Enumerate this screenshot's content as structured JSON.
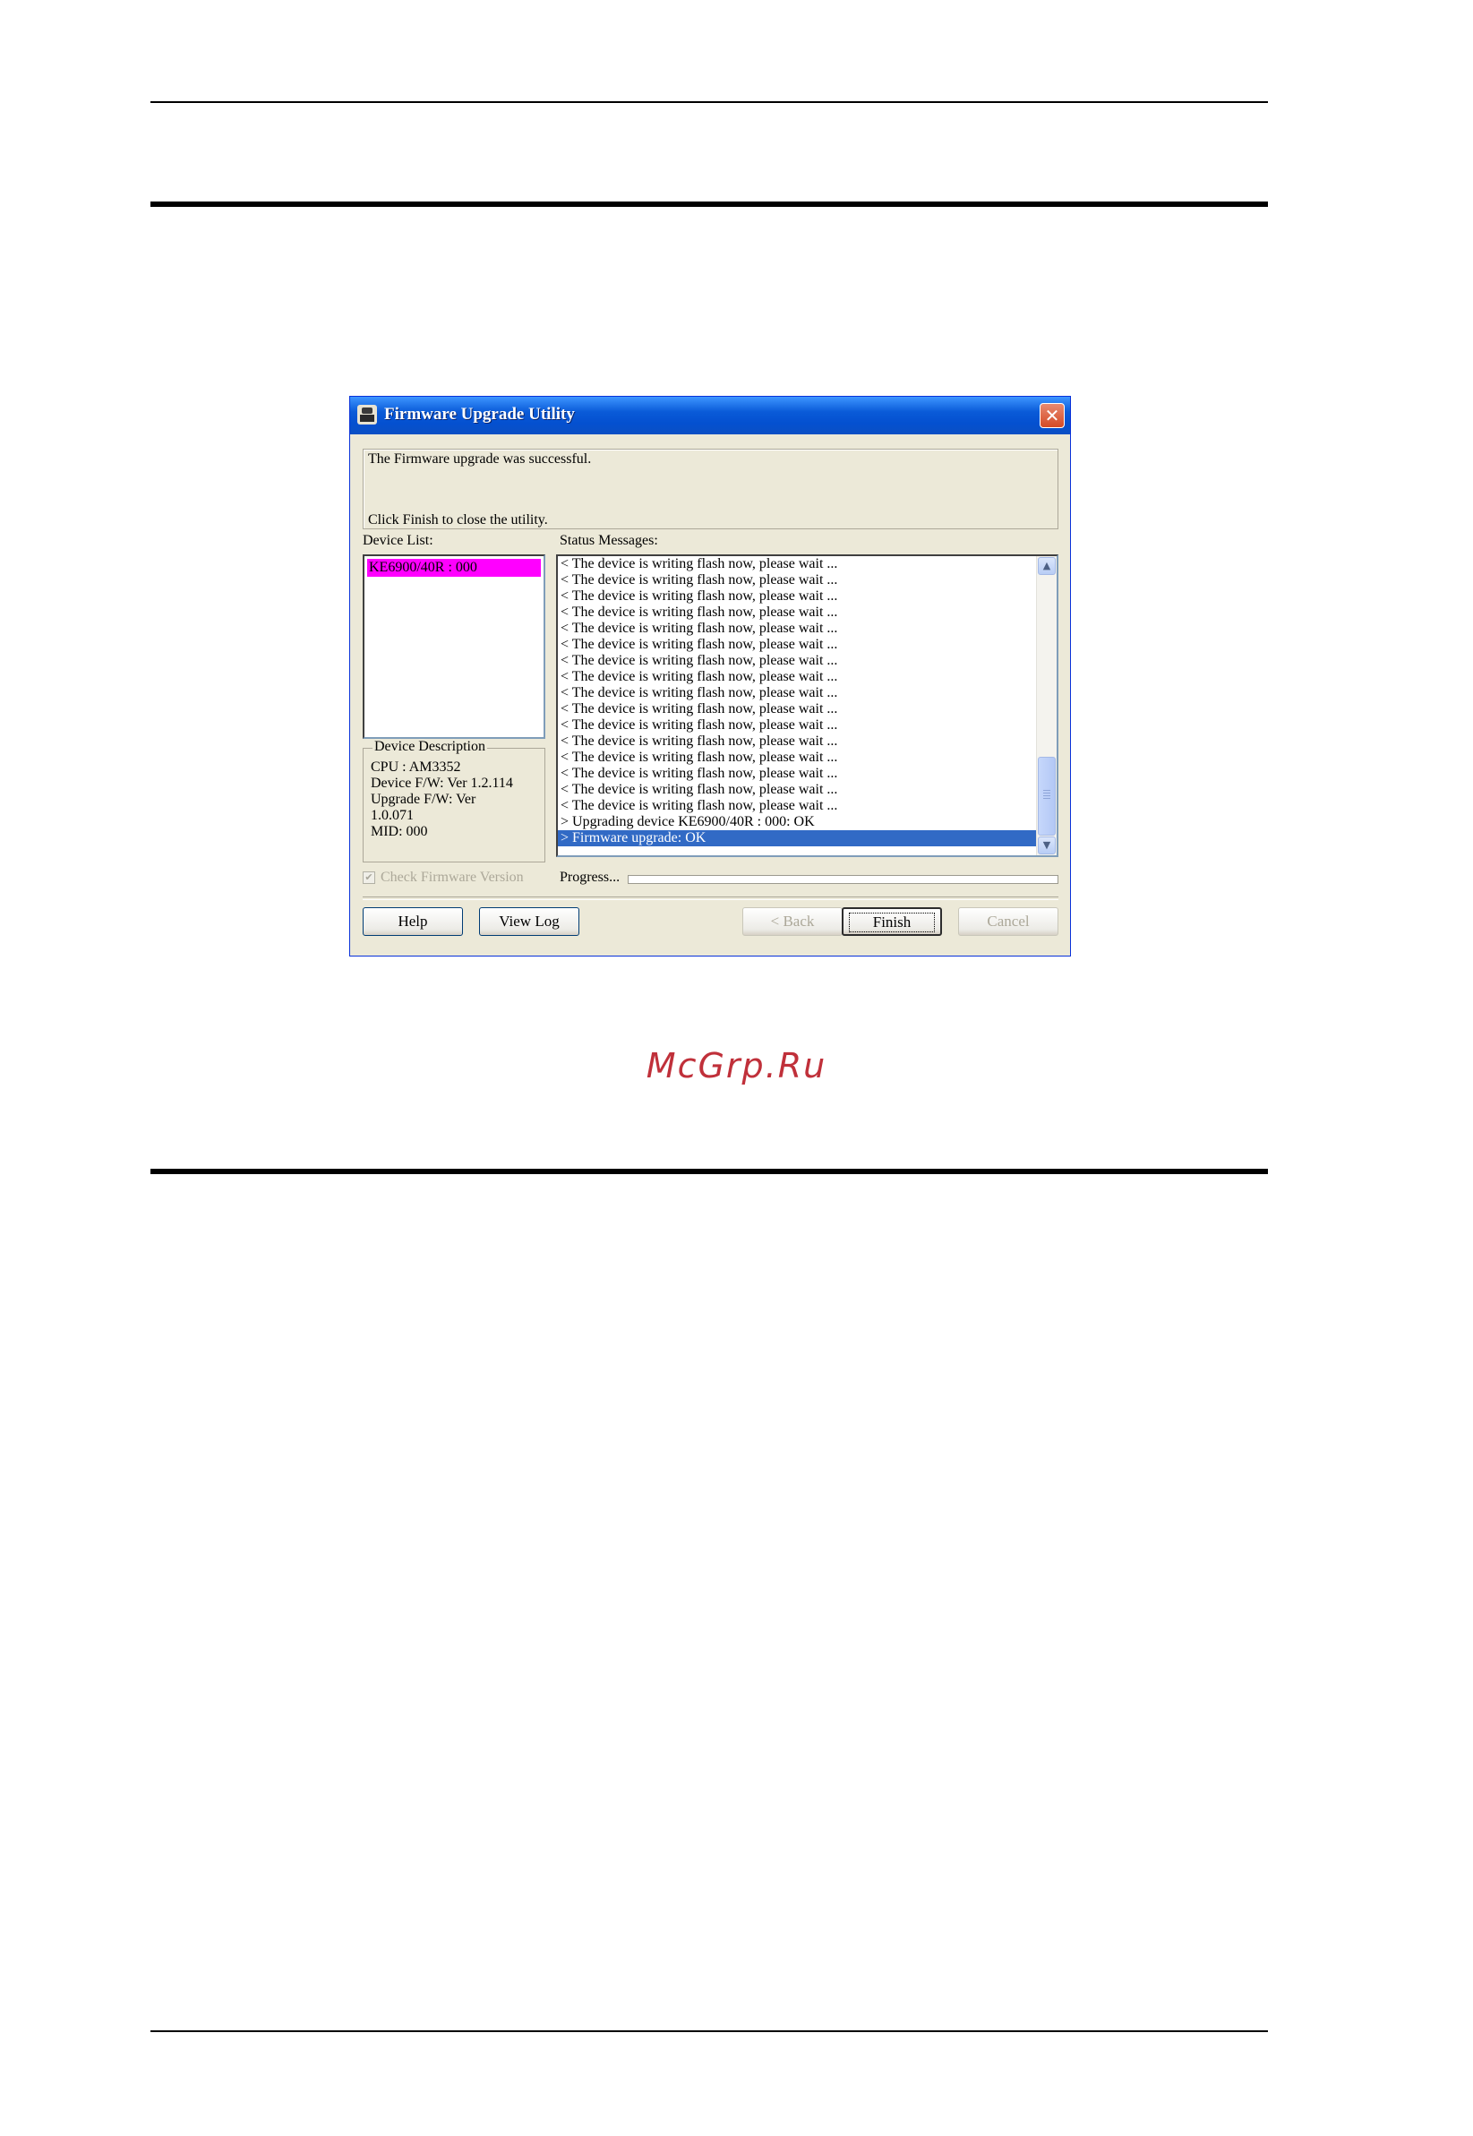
{
  "watermark": "McGrp.Ru",
  "dialog": {
    "title": "Firmware Upgrade Utility",
    "close_icon": "close-icon",
    "info": {
      "line1": "The Firmware upgrade was successful.",
      "line2": "Click Finish to close the utility."
    },
    "device_list": {
      "label": "Device List:",
      "items": [
        "KE6900/40R : 000"
      ]
    },
    "device_description": {
      "label": "Device Description",
      "lines": [
        "CPU : AM3352",
        "Device F/W: Ver 1.2.114",
        "Upgrade F/W: Ver",
        "1.0.071",
        "MID: 000"
      ]
    },
    "status": {
      "label": "Status Messages:",
      "lines": [
        "< The device is writing flash now, please wait ...",
        "< The device is writing flash now, please wait ...",
        "< The device is writing flash now, please wait ...",
        "< The device is writing flash now, please wait ...",
        "< The device is writing flash now, please wait ...",
        "< The device is writing flash now, please wait ...",
        "< The device is writing flash now, please wait ...",
        "< The device is writing flash now, please wait ...",
        "< The device is writing flash now, please wait ...",
        "< The device is writing flash now, please wait ...",
        "< The device is writing flash now, please wait ...",
        "< The device is writing flash now, please wait ...",
        "< The device is writing flash now, please wait ...",
        "< The device is writing flash now, please wait ...",
        "< The device is writing flash now, please wait ...",
        "< The device is writing flash now, please wait ...",
        "> Upgrading device KE6900/40R : 000: OK",
        "> Firmware upgrade: OK"
      ],
      "selected_index": 17
    },
    "check_firmware_label": "Check Firmware Version",
    "check_firmware_checked": true,
    "progress_label": "Progress...",
    "progress_value": 0,
    "buttons": {
      "help": "Help",
      "view_log": "View Log",
      "back": "< Back",
      "finish": "Finish",
      "cancel": "Cancel"
    }
  }
}
